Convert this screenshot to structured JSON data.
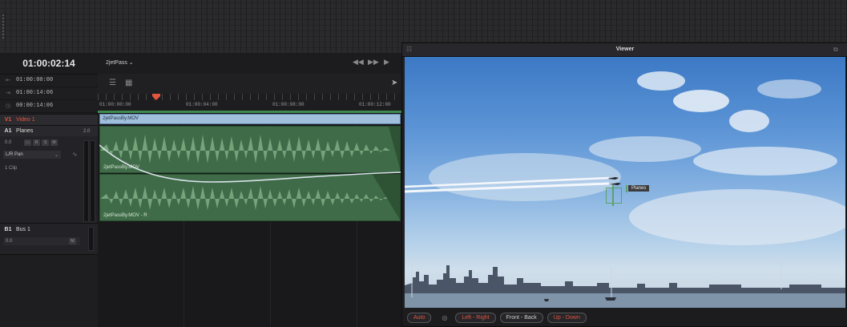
{
  "timeline": {
    "timecode": "01:00:02:14",
    "timeline_name": "2jetPass",
    "in_time": "01:00:00:00",
    "out_time": "01:00:14:06",
    "duration": "00:00:14:06",
    "ruler_labels": [
      "01:00:00:00",
      "01:00:04:00",
      "01:00:08:00",
      "01:00:12:00"
    ]
  },
  "tracks": {
    "v1": {
      "id": "V1",
      "name": "Video 1"
    },
    "a1": {
      "id": "A1",
      "name": "Planes",
      "channel": "2.0",
      "level": "0.0",
      "pan": "L/R Pan",
      "clip_count": "1 Clip",
      "buttons": [
        "R",
        "S",
        "M"
      ]
    },
    "b1": {
      "id": "B1",
      "name": "Bus 1",
      "level": "0.0",
      "mute": "M"
    }
  },
  "clips": {
    "video": "2jetPassBy.MOV",
    "audio_l": "2jetPassBy.MOV",
    "audio_r": "2jetPassBy.MOV - R"
  },
  "viewer": {
    "title": "Viewer",
    "object_label": "Planes",
    "footer_buttons": [
      {
        "label": "Auto",
        "color": "#e4553e"
      },
      {
        "label": "Left - Right",
        "color": "#e4553e"
      },
      {
        "label": "Front - Back",
        "color": "#cfcfcf"
      },
      {
        "label": "Up - Down",
        "color": "#e4553e"
      }
    ]
  },
  "colors": {
    "accent_red": "#e4553e",
    "audio_clip": "#3f6b48",
    "video_clip": "#9fbfdc",
    "waveform": "#7fae85"
  }
}
